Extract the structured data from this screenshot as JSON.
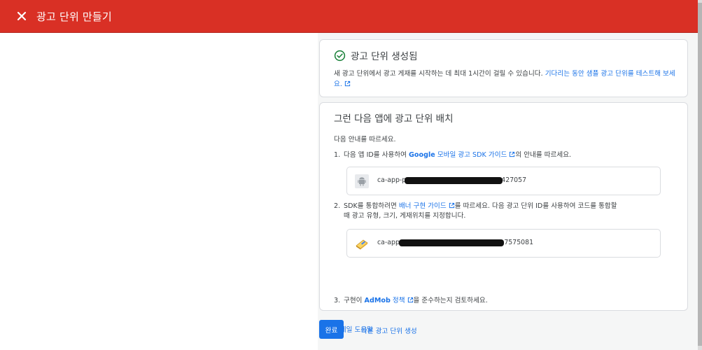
{
  "header": {
    "title": "광고 단위 만들기",
    "close_icon": "close-icon"
  },
  "success": {
    "title": "광고 단위 생성됨",
    "desc_text": "새 광고 단위에서 광고 게재를 시작하는 데 최대 1시간이 걸릴 수 있습니다. ",
    "desc_link": "기다리는 동안 샘플 광고 단위를 테스트해 보세요.",
    "icon": "check-circle-icon"
  },
  "placement": {
    "title": "그런 다음 앱에 광고 단위 배치",
    "guide": "다음 안내를 따르세요.",
    "step1": {
      "num": "1.",
      "pre": "다음 앱 ID를 사용하여 ",
      "link_bold": "Google",
      "link_rest": " 모바일 광고 SDK 가이드",
      "post": "의 안내를 따르세요."
    },
    "app_id": {
      "prefix": "ca-app-p",
      "suffix": "427057",
      "icon": "android-icon"
    },
    "step2": {
      "num": "2.",
      "pre": "SDK를 통합하려면 ",
      "link": "배너 구현 가이드",
      "post": "를 따르세요. 다음 광고 단위 ID를 사용하여 코드를 통합할",
      "line2": "때 광고 유형, 크기, 게재위치를 지정합니다."
    },
    "ad_unit_id": {
      "prefix": "ca-app-",
      "suffix": "7575081",
      "icon": "ad-unit-icon"
    },
    "step3": {
      "num": "3.",
      "pre": "구현이 ",
      "link_bold": "AdMob",
      "link_rest": " 정책",
      "post": "을 준수하는지 검토하세요."
    },
    "email_help": "이메일 도움말"
  },
  "footer": {
    "done_label": "완료",
    "another_label": "다른 광고 단위 생성"
  },
  "colors": {
    "topbar": "#d93025",
    "link": "#1a73e8",
    "success": "#188038"
  }
}
